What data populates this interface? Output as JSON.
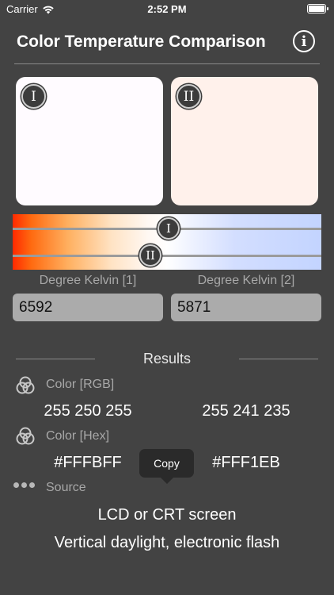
{
  "status_bar": {
    "carrier": "Carrier",
    "time": "2:52 PM",
    "battery_level": 1.0
  },
  "nav": {
    "title": "Color Temperature Comparison",
    "info_glyph": "i"
  },
  "swatches": [
    {
      "badge": "I",
      "color": "#FFFBFF"
    },
    {
      "badge": "II",
      "color": "#FFF1EB"
    }
  ],
  "sliders": [
    {
      "badge": "I",
      "kelvin": 6592
    },
    {
      "badge": "II",
      "kelvin": 5871
    }
  ],
  "kelvin": {
    "label_1": "Degree Kelvin [1]",
    "label_2": "Degree Kelvin [2]",
    "value_1": "6592",
    "value_2": "5871"
  },
  "results": {
    "title": "Results",
    "rgb_label": "Color [RGB]",
    "rgb_1": "255 250 255",
    "rgb_2": "255 241 235",
    "hex_label": "Color [Hex]",
    "hex_1": "#FFFBFF",
    "hex_2": "#FFF1EB",
    "source_label": "Source",
    "source_1": "LCD or CRT screen",
    "source_2": "Vertical daylight, electronic flash"
  },
  "tooltip": {
    "label": "Copy"
  },
  "icons": {
    "wifi": "wifi-icon",
    "battery": "battery-icon",
    "info": "info-icon",
    "rgb": "rgb-circles-icon",
    "hex": "rgb-circles-icon",
    "source": "dots-icon"
  },
  "colors": {
    "background": "#434343",
    "input_bg": "#ABABAB",
    "label_gray": "#A8A8A8"
  }
}
